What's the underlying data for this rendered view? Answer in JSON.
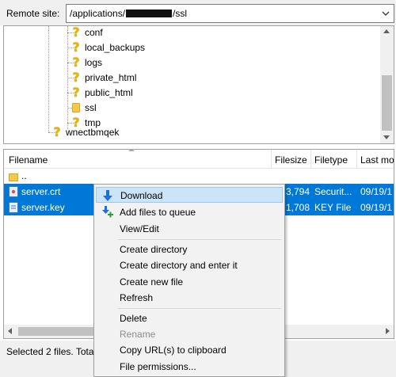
{
  "remote_site": {
    "label": "Remote site:",
    "path_prefix": "/applications/",
    "path_suffix": "/ssl"
  },
  "tree": {
    "items": [
      {
        "label": "conf",
        "icon": "question-mark-folder-icon"
      },
      {
        "label": "local_backups",
        "icon": "question-mark-folder-icon"
      },
      {
        "label": "logs",
        "icon": "question-mark-folder-icon"
      },
      {
        "label": "private_html",
        "icon": "question-mark-folder-icon"
      },
      {
        "label": "public_html",
        "icon": "question-mark-folder-icon"
      },
      {
        "label": "ssl",
        "icon": "folder-icon"
      },
      {
        "label": "tmp",
        "icon": "question-mark-folder-icon"
      },
      {
        "label": "wnectbmqek",
        "icon": "question-mark-folder-icon"
      }
    ]
  },
  "file_list": {
    "columns": {
      "filename": "Filename",
      "filesize": "Filesize",
      "filetype": "Filetype",
      "last_modified": "Last mo"
    },
    "rows": [
      {
        "name": "..",
        "size": "",
        "type": "",
        "modified": "",
        "icon": "parent-folder-icon"
      },
      {
        "name": "server.crt",
        "size": "3,794",
        "type": "Securit...",
        "modified": "09/19/1",
        "icon": "certificate-file-icon"
      },
      {
        "name": "server.key",
        "size": "1,708",
        "type": "KEY File",
        "modified": "09/19/1",
        "icon": "key-file-icon"
      }
    ]
  },
  "context_menu": {
    "download": "Download",
    "add_to_queue": "Add files to queue",
    "view_edit": "View/Edit",
    "create_directory": "Create directory",
    "create_directory_enter": "Create directory and enter it",
    "create_new_file": "Create new file",
    "refresh": "Refresh",
    "delete": "Delete",
    "rename": "Rename",
    "copy_url": "Copy URL(s) to clipboard",
    "file_permissions": "File permissions..."
  },
  "status": {
    "text": "Selected 2 files. Tota"
  },
  "colors": {
    "selection": "#0078d7",
    "menu_highlight": "#cce4f7",
    "window_bg": "#f0f0f0"
  }
}
